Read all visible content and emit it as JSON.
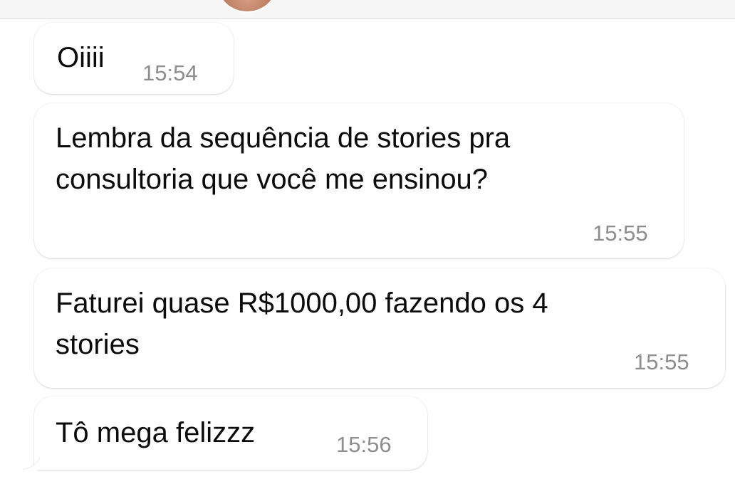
{
  "conversation": {
    "messages": [
      {
        "text_lines": [
          "Oiiii"
        ],
        "time": "15:54"
      },
      {
        "text_lines": [
          "Lembra da sequência de stories pra",
          "consultoria que você me ensinou?"
        ],
        "time": "15:55"
      },
      {
        "text_lines": [
          "Faturei quase R$1000,00 fazendo os 4",
          "stories"
        ],
        "time": "15:55"
      },
      {
        "text_lines": [
          "Tô mega felizzz"
        ],
        "time": "15:56"
      }
    ]
  },
  "colors": {
    "bubble_background": "#ffffff",
    "text": "#0b0b0b",
    "timestamp": "#8d8d8d",
    "top_bar": "#f7f7f7"
  }
}
